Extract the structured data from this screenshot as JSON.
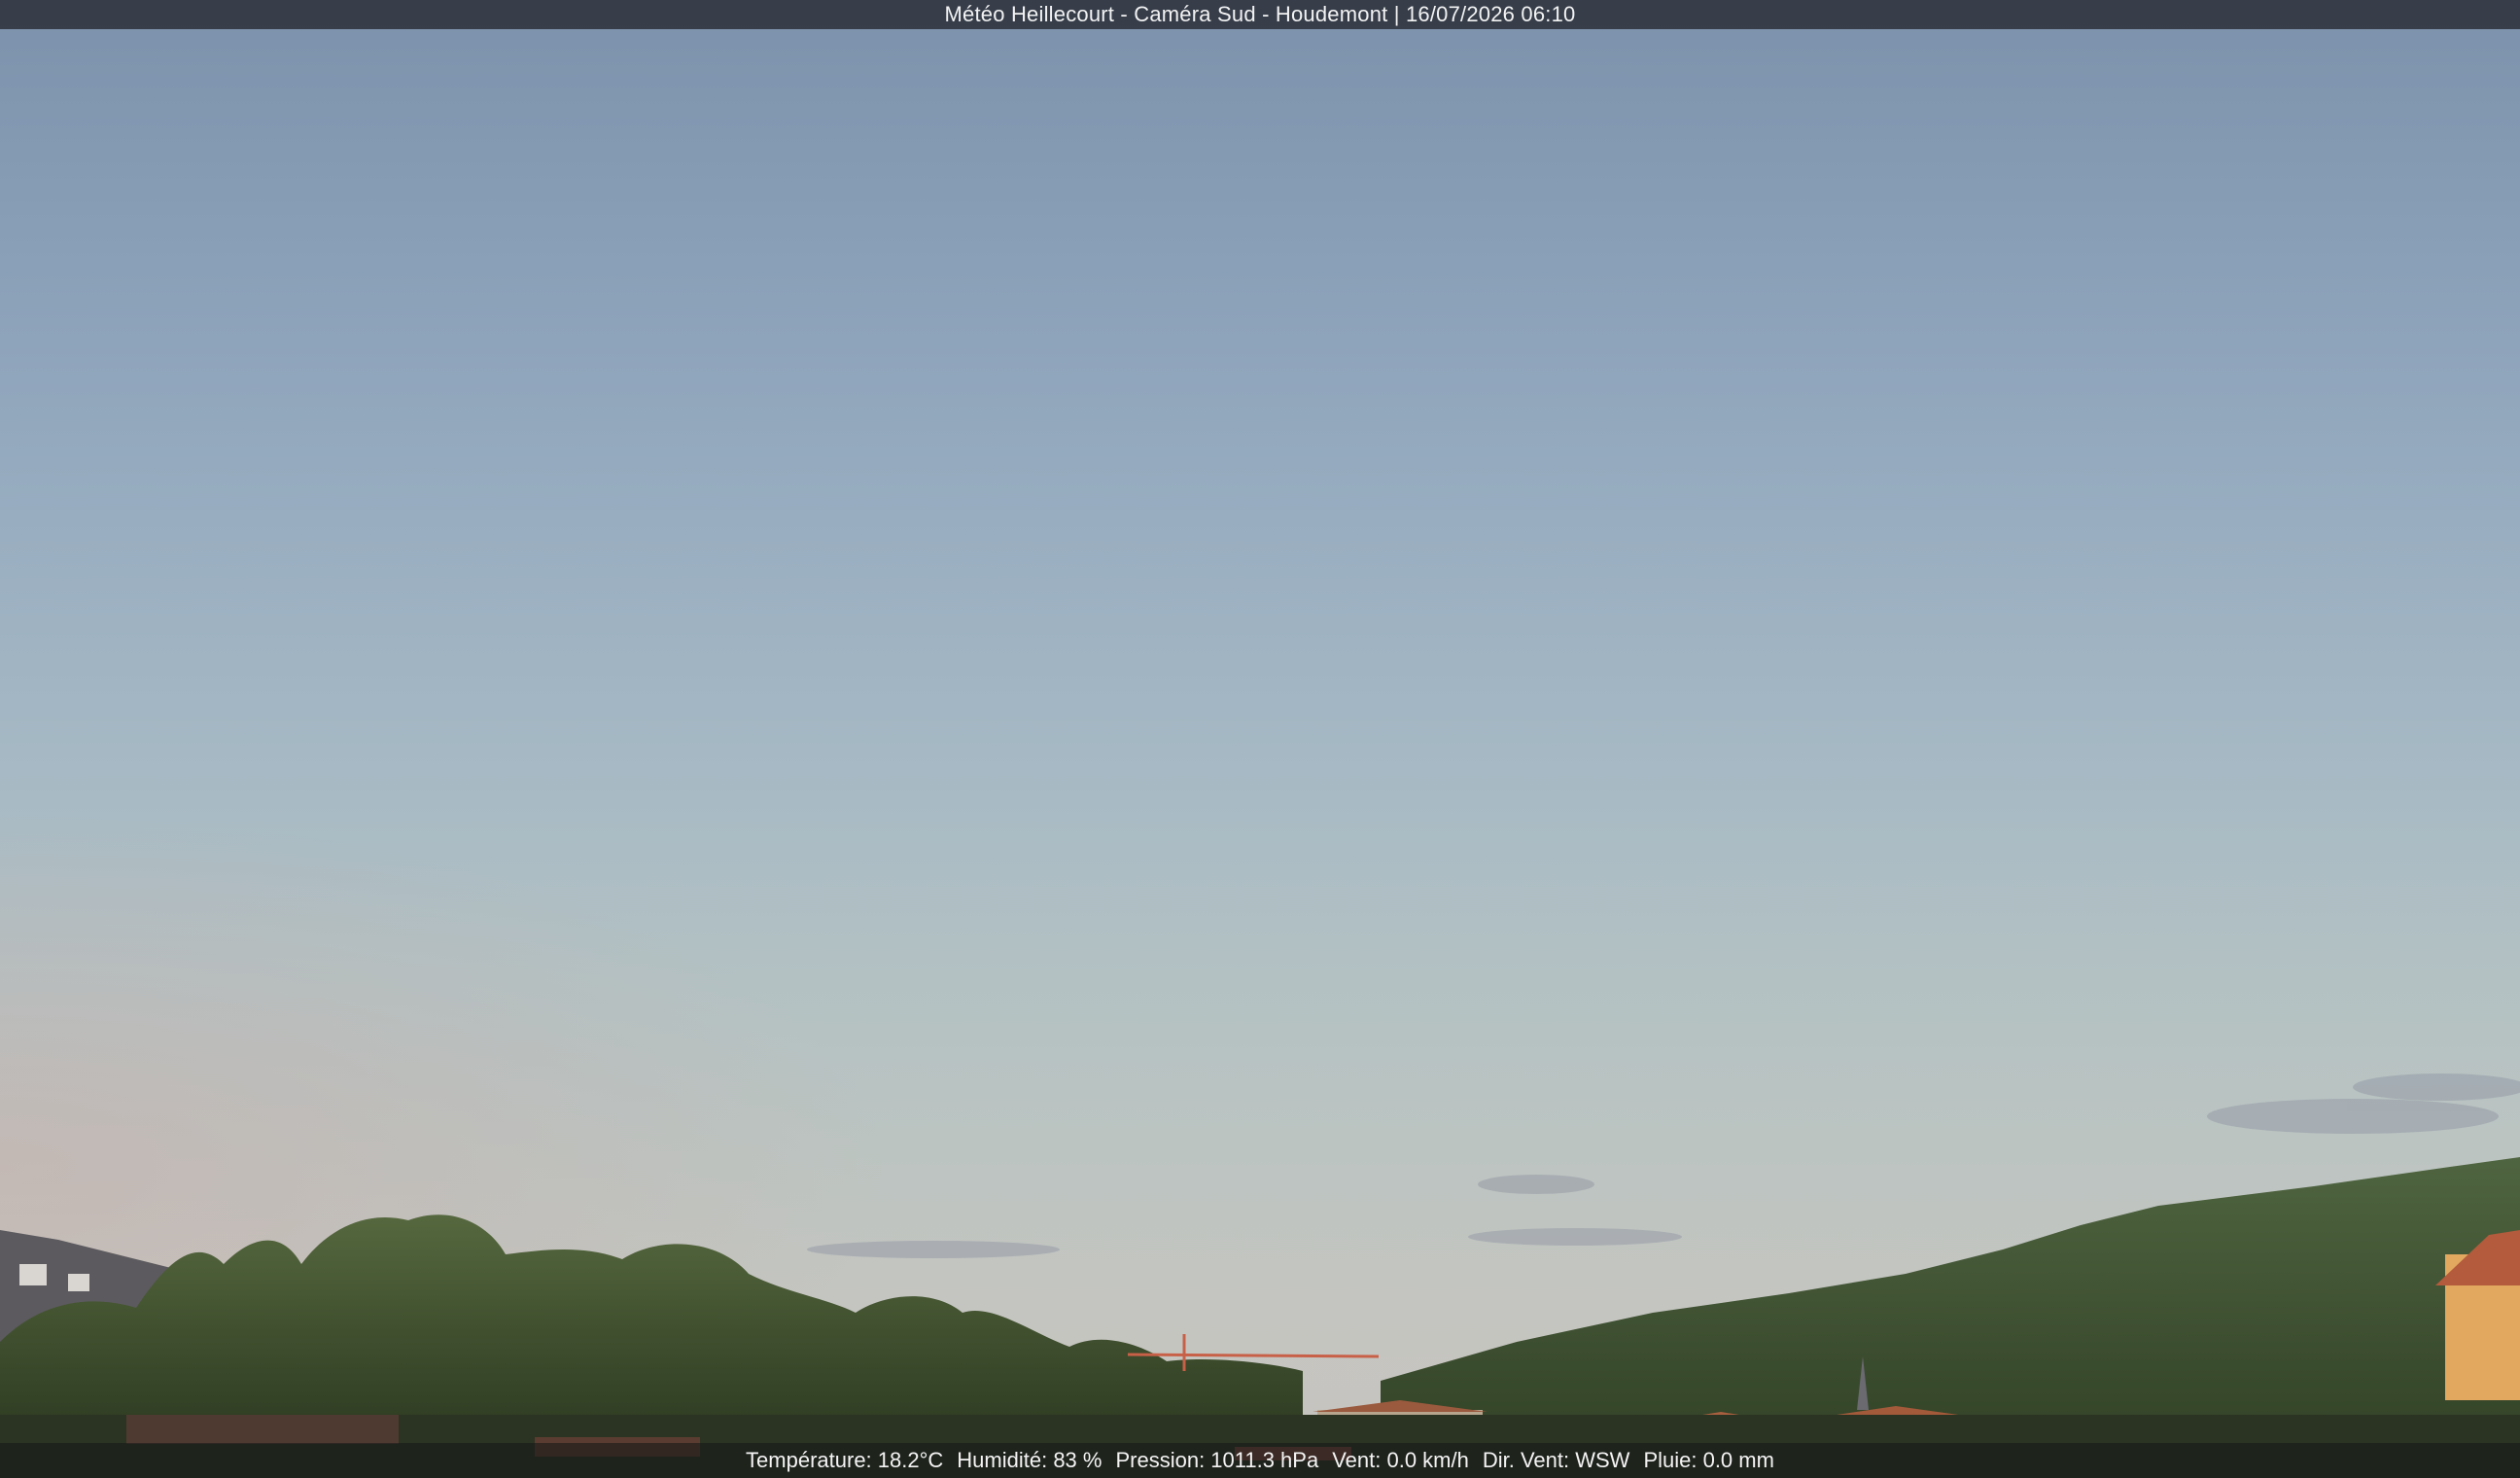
{
  "webcam": {
    "title": "Météo Heillecourt - Caméra Sud - Houdemont | 16/07/2026 06:10"
  },
  "weather": {
    "temperature": "Température: 18.2°C",
    "humidity": "Humidité: 83 %",
    "pressure": "Pression: 1011.3 hPa",
    "wind": "Vent: 0.0 km/h",
    "wind_dir": "Dir. Vent: WSW",
    "rain": "Pluie: 0.0 mm"
  },
  "colors": {
    "sky_top": "#7c92ac",
    "sky_horizon": "#c8c4bf",
    "vegetation": "#3d5230",
    "roofs": "#9a5a3e"
  }
}
